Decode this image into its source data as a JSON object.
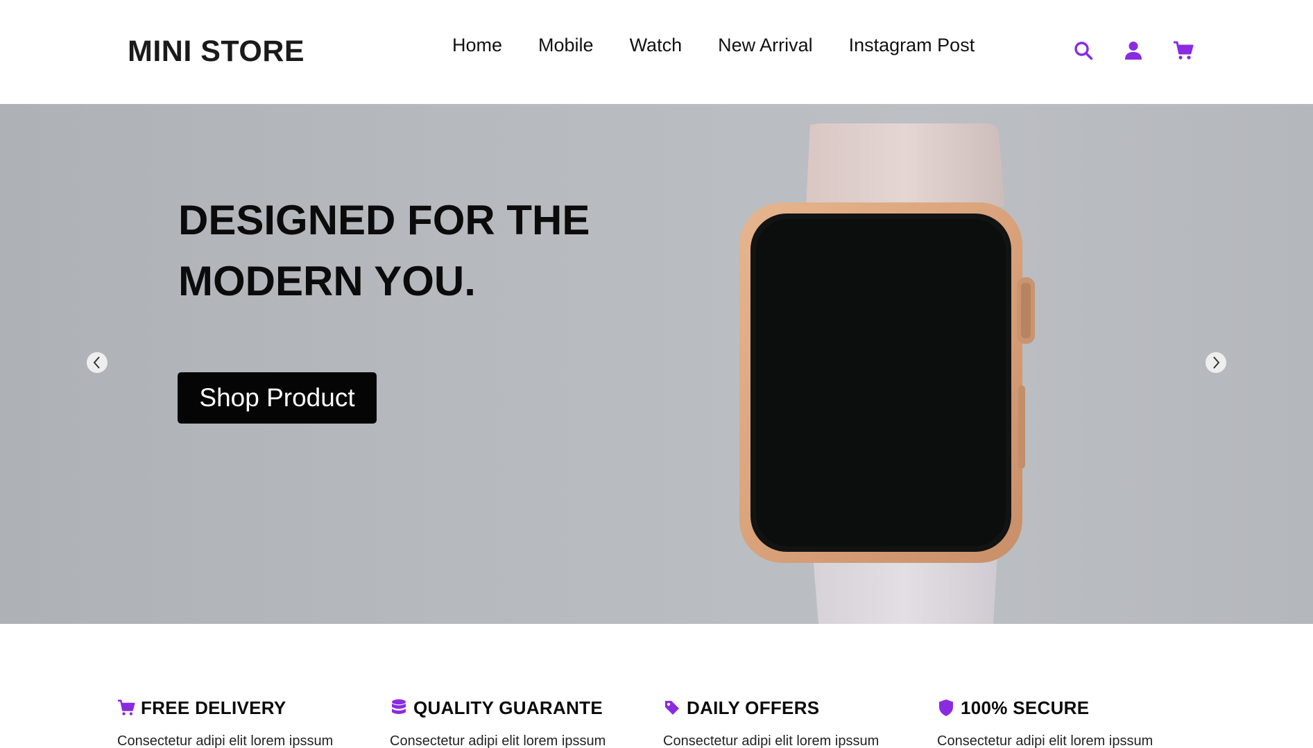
{
  "header": {
    "logo": "MINI STORE",
    "nav": [
      "Home",
      "Mobile",
      "Watch",
      "New Arrival",
      "Instagram Post"
    ],
    "icons": [
      "search-icon",
      "user-icon",
      "cart-icon"
    ]
  },
  "hero": {
    "title_line1": "DESIGNED FOR THE",
    "title_line2": "MODERN YOU.",
    "button_label": "Shop Product",
    "prev_icon": "chevron-left-icon",
    "next_icon": "chevron-right-icon"
  },
  "features": [
    {
      "icon": "cart-icon",
      "title": "FREE DELIVERY",
      "text": "Consectetur adipi elit lorem ipssum"
    },
    {
      "icon": "database-icon",
      "title": "QUALITY GUARANTE",
      "text": "Consectetur adipi elit lorem ipssum"
    },
    {
      "icon": "tag-icon",
      "title": "DAILY OFFERS",
      "text": "Consectetur adipi elit lorem ipssum"
    },
    {
      "icon": "shield-icon",
      "title": "100% SECURE",
      "text": "Consectetur adipi elit lorem ipssum"
    }
  ],
  "colors": {
    "accent": "#8a2be2",
    "hero_bg": "#b6babe",
    "button_bg": "#050505"
  }
}
